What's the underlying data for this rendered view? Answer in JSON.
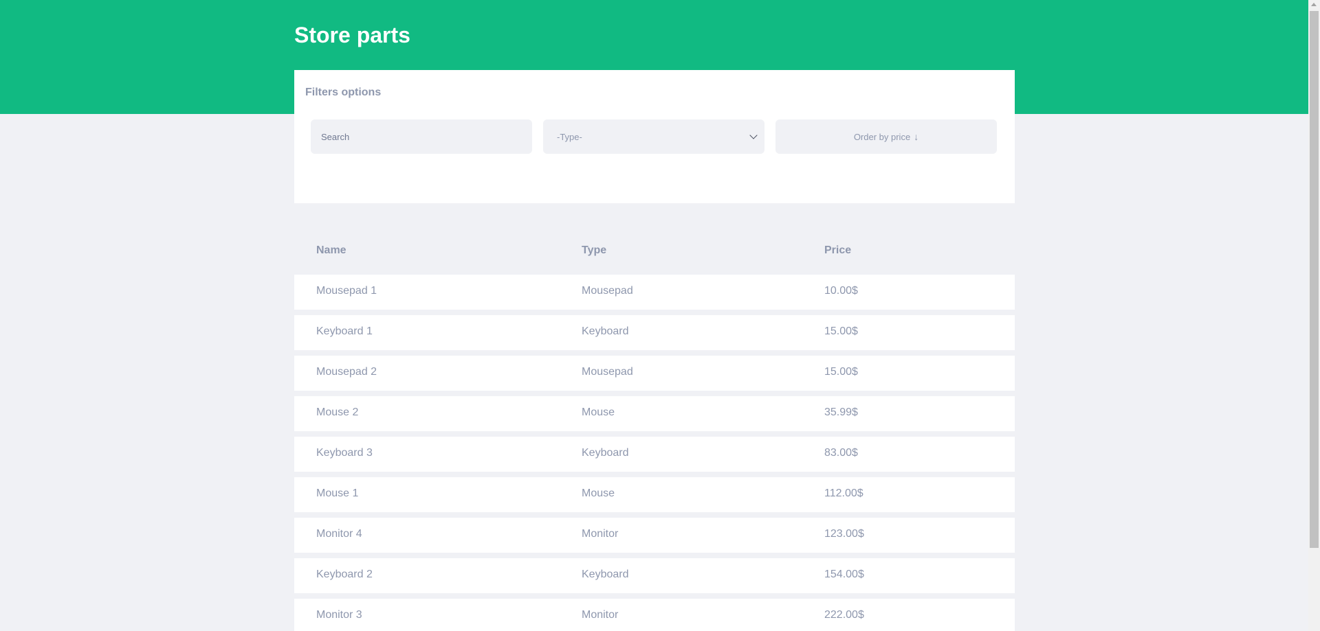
{
  "header": {
    "title": "Store parts",
    "background_color": "#11ba82"
  },
  "filters": {
    "title": "Filters options",
    "search_placeholder": "Search",
    "search_value": "",
    "type_select_value": "-Type-",
    "order_button_label": "Order by price",
    "order_icon": "arrow-down-icon"
  },
  "table": {
    "columns": [
      "Name",
      "Type",
      "Price"
    ],
    "rows": [
      {
        "name": "Mousepad 1",
        "type": "Mousepad",
        "price": "10.00$"
      },
      {
        "name": "Keyboard 1",
        "type": "Keyboard",
        "price": "15.00$"
      },
      {
        "name": "Mousepad 2",
        "type": "Mousepad",
        "price": "15.00$"
      },
      {
        "name": "Mouse 2",
        "type": "Mouse",
        "price": "35.99$"
      },
      {
        "name": "Keyboard 3",
        "type": "Keyboard",
        "price": "83.00$"
      },
      {
        "name": "Mouse 1",
        "type": "Mouse",
        "price": "112.00$"
      },
      {
        "name": "Monitor 4",
        "type": "Monitor",
        "price": "123.00$"
      },
      {
        "name": "Keyboard 2",
        "type": "Keyboard",
        "price": "154.00$"
      },
      {
        "name": "Monitor 3",
        "type": "Monitor",
        "price": "222.00$"
      }
    ]
  },
  "colors": {
    "accent": "#11ba82",
    "page_background": "#f0f1f5",
    "muted_text": "#8e97ad"
  }
}
